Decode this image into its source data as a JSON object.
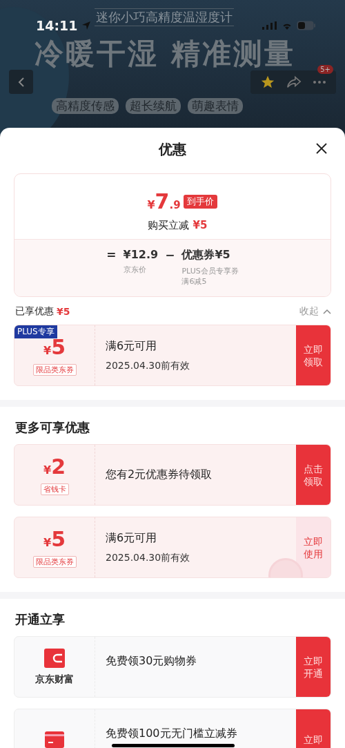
{
  "status_bar": {
    "time": "14:11",
    "notification_badge": "5+"
  },
  "banner": {
    "subtitle": "迷你小巧高精度温湿度计",
    "headline": "冷暖干湿 精准测量",
    "tags": [
      "高精度传感",
      "超长续航",
      "萌趣表情"
    ]
  },
  "sheet": {
    "title": "优惠",
    "summary": {
      "currency": "¥",
      "price_int": "7",
      "price_dec": ".9",
      "price_tag": "到手价",
      "discount_label": "购买立减",
      "discount_amount": "¥5",
      "formula": [
        {
          "kind": "symbol",
          "text": "="
        },
        {
          "kind": "term",
          "value": "¥12.9",
          "notes": [
            "京东价"
          ]
        },
        {
          "kind": "symbol",
          "text": "−"
        },
        {
          "kind": "term",
          "value": "优惠券¥5",
          "notes": [
            "PLUS会员专享券",
            "满6减5"
          ]
        }
      ]
    },
    "applied": {
      "label": "已享优惠",
      "amount": "¥5",
      "toggle": "收起",
      "expanded": true,
      "items": [
        {
          "kind": "coupon",
          "currency": "¥",
          "amount": "5",
          "tag": "限品类东券",
          "badge": "PLUS专享",
          "condition": "满6元可用",
          "validity": "2025.04.30前有效",
          "action": "立即领取",
          "claimed": false
        }
      ]
    },
    "groups": [
      {
        "title": "更多可享优惠",
        "items": [
          {
            "kind": "coupon",
            "currency": "¥",
            "amount": "2",
            "tag": "省钱卡",
            "condition": "您有2元优惠券待领取",
            "action": "点击领取",
            "claimed": false
          },
          {
            "kind": "coupon",
            "currency": "¥",
            "amount": "5",
            "tag": "限品类东券",
            "condition": "满6元可用",
            "validity": "2025.04.30前有效",
            "action": "立即使用",
            "claimed": true
          }
        ]
      },
      {
        "title": "开通立享",
        "items": [
          {
            "kind": "service",
            "name": "京东财富",
            "condition": "免费领30元购物券",
            "action": "立即开通"
          },
          {
            "kind": "service",
            "condition": "免费领100元无门槛立减券",
            "action": "立即"
          }
        ]
      }
    ]
  }
}
